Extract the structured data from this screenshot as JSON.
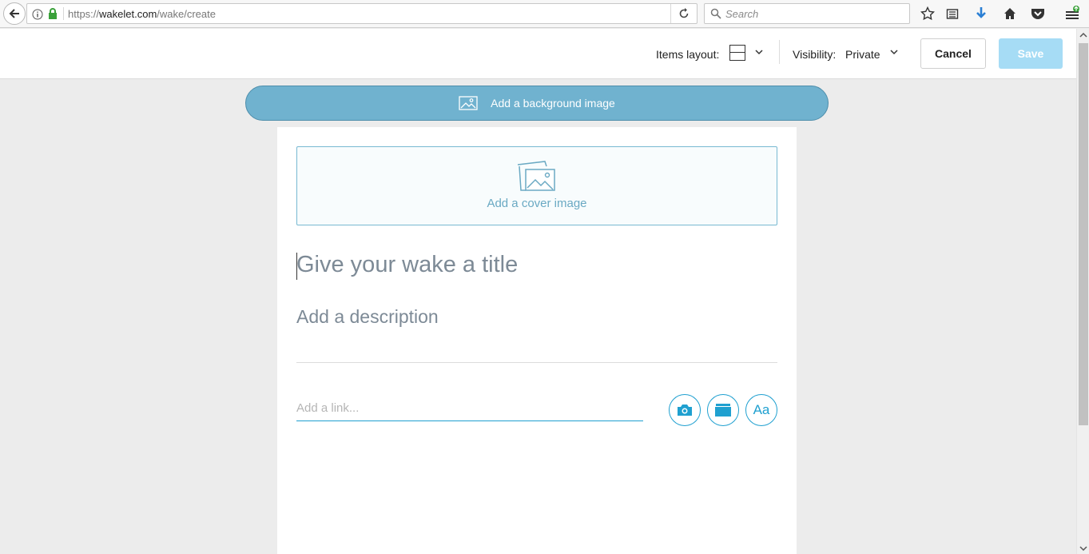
{
  "browser": {
    "url_prefix": "https://",
    "url_domain": "wakelet.com",
    "url_path": "/wake/create",
    "search_placeholder": "Search"
  },
  "header": {
    "items_layout_label": "Items layout:",
    "visibility_label": "Visibility:",
    "visibility_value": "Private",
    "cancel_label": "Cancel",
    "save_label": "Save"
  },
  "editor": {
    "background_image_label": "Add a background image",
    "cover_image_label": "Add a cover image",
    "title_placeholder": "Give your wake a title",
    "description_placeholder": "Add a description",
    "link_placeholder": "Add a link...",
    "text_button_label": "Aa"
  },
  "colors": {
    "accent": "#1fa0d0",
    "bg_button": "#70b2cf",
    "save_disabled": "#a6dcf5"
  }
}
